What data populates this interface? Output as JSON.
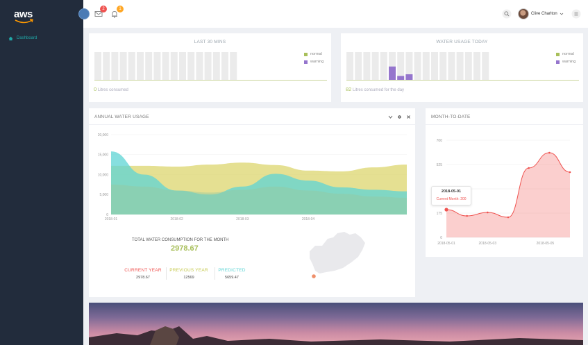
{
  "brand": {
    "logo_text": "aws"
  },
  "sidebar": {
    "items": [
      {
        "label": "Dashboard"
      }
    ]
  },
  "topbar": {
    "mail_badge": "2",
    "bell_badge": "1",
    "user_name": "Clive Charlton"
  },
  "colors": {
    "normal": "#a8bf5a",
    "warning": "#9575cd",
    "current": "#ef5350",
    "previous": "#cdd45a",
    "predicted": "#5ed4d4"
  },
  "cards": {
    "last30": {
      "title": "LAST 30 MINS",
      "legend": [
        "normal",
        "warning"
      ],
      "footer_value": "0",
      "footer_label": "Litres consumed",
      "bars_normal": [
        0,
        0,
        0,
        0,
        0,
        0,
        0,
        0,
        0,
        0,
        0,
        0,
        0,
        0,
        0,
        0,
        0
      ],
      "bars_warning": [
        0,
        0,
        0,
        0,
        0,
        0,
        0,
        0,
        0,
        0,
        0,
        0,
        0,
        0,
        0,
        0,
        0
      ]
    },
    "today": {
      "title": "WATER USAGE TODAY",
      "legend": [
        "normal",
        "warning"
      ],
      "footer_value": "82",
      "footer_label": "Litres consumed for the day",
      "bars_warning": [
        0,
        0,
        0,
        0,
        0,
        48,
        14,
        20,
        0,
        0,
        0,
        0,
        0,
        0,
        0,
        0,
        0
      ]
    },
    "annual": {
      "title": "ANNUAL WATER USAGE",
      "total_label": "TOTAL WATER CONSUMPTION FOR THE MONTH",
      "total_value": "2978.67",
      "stats": [
        {
          "label": "CURRENT YEAR",
          "value": "2978.67"
        },
        {
          "label": "PREVIOUS YEAR",
          "value": "12569"
        },
        {
          "label": "PREDICTED",
          "value": "5659.47"
        }
      ]
    },
    "mtd": {
      "title": "MONTH-TO-DATE",
      "tooltip_title": "2018-05-01",
      "tooltip_text": "Current Month: 200"
    }
  },
  "chart_data": [
    {
      "type": "area",
      "title": "ANNUAL WATER USAGE",
      "x": [
        0,
        0.5,
        1,
        1.5,
        2,
        2.5,
        3,
        3.5,
        4,
        4.5
      ],
      "x_tick_labels": [
        "2018-01",
        "2018-02",
        "2018-03",
        "2018-04"
      ],
      "ylim": [
        0,
        20000
      ],
      "y_ticks": [
        0,
        5000,
        10000,
        15000,
        20000
      ],
      "y_tick_labels": [
        "0",
        "5,000",
        "10,000",
        "15,000",
        "20,000"
      ],
      "series": [
        {
          "values": [
            12200,
            12200,
            12000,
            12500,
            13000,
            12400,
            11000,
            10800,
            11800,
            12500
          ]
        },
        {
          "values": [
            15800,
            10000,
            6000,
            5000,
            7000,
            10200,
            8500,
            6800,
            6200,
            5800
          ]
        },
        {
          "values": [
            7500,
            7000,
            6000,
            5500,
            6200,
            7000,
            6000,
            5200,
            4500,
            4200
          ]
        }
      ]
    },
    {
      "type": "area",
      "title": "MONTH-TO-DATE",
      "x": [
        0,
        1,
        2,
        3,
        4,
        5,
        6
      ],
      "x_tick_labels": [
        "2018-05-01",
        "2018-05-03",
        "2018-05-05"
      ],
      "x_tick_positions": [
        0,
        2,
        4.8
      ],
      "ylim": [
        0,
        700
      ],
      "y_ticks": [
        0,
        175,
        350,
        525,
        700
      ],
      "y_tick_labels": [
        "0",
        "175",
        "350",
        "525",
        "700"
      ],
      "series": [
        {
          "name": "Current Month",
          "values": [
            200,
            155,
            180,
            145,
            500,
            610,
            470
          ]
        }
      ]
    }
  ]
}
